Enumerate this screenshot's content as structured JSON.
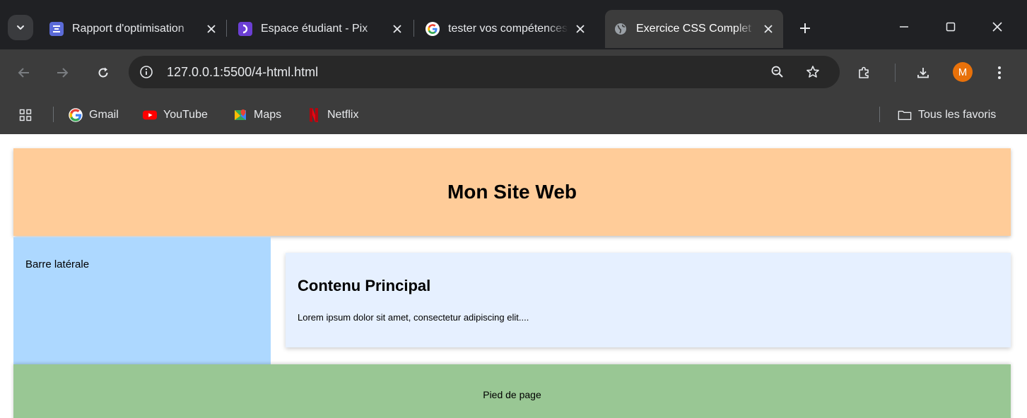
{
  "browser": {
    "tabs": [
      {
        "title": "Rapport d'optimisation",
        "favicon": "report-icon",
        "favicon_color": "#5b6bd8"
      },
      {
        "title": "Espace étudiant - Pix",
        "favicon": "pix-icon",
        "favicon_color": "#6b3fd4"
      },
      {
        "title": "tester vos compétences",
        "favicon": "google-icon",
        "favicon_color": "#ffffff"
      },
      {
        "title": "Exercice CSS Complet",
        "favicon": "globe-icon",
        "favicon_color": "#9aa0a6",
        "active": true
      }
    ],
    "address_bar": {
      "url": "127.0.0.1:5500/4-html.html"
    },
    "bookmarks": [
      {
        "label": "Gmail",
        "icon": "google-icon"
      },
      {
        "label": "YouTube",
        "icon": "youtube-icon"
      },
      {
        "label": "Maps",
        "icon": "maps-icon"
      },
      {
        "label": "Netflix",
        "icon": "netflix-icon"
      }
    ],
    "all_bookmarks_label": "Tous les favoris",
    "profile_initial": "M",
    "colors": {
      "frame": "#202124",
      "toolbar": "#3c3c3c",
      "avatar": "#e8710a"
    }
  },
  "page": {
    "header_title": "Mon Site Web",
    "sidebar_text": "Barre latérale",
    "main_title": "Contenu Principal",
    "main_text": "Lorem ipsum dolor sit amet, consectetur adipiscing elit....",
    "footer_text": "Pied de page",
    "colors": {
      "header": "#ffcc99",
      "sidebar": "#add8ff",
      "main": "#e6f0ff",
      "footer": "#99c794"
    }
  }
}
